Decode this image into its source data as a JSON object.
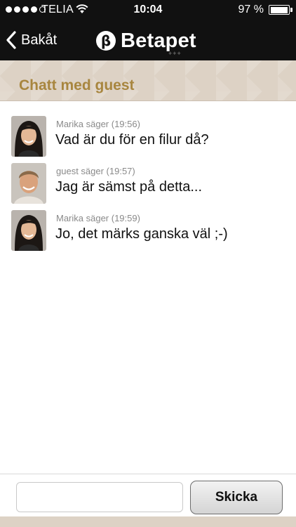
{
  "status_bar": {
    "signal_bars_filled": 4,
    "signal_bars_total": 5,
    "carrier": "TELIA",
    "time": "10:04",
    "battery": "97 %",
    "battery_level": 0.97
  },
  "nav": {
    "back_label": "Bakåt",
    "logo_text": "Betapet",
    "logo_mark_glyph": "β",
    "logo_subtext": "+++"
  },
  "header": {
    "title": "Chatt med guest"
  },
  "messages": [
    {
      "meta": "Marika säger (19:56)",
      "text": "Vad är du för en filur då?",
      "avatar": "woman-avatar"
    },
    {
      "meta": "guest säger (19:57)",
      "text": "Jag är sämst på detta...",
      "avatar": "man-avatar"
    },
    {
      "meta": "Marika säger (19:59)",
      "text": "Jo, det märks ganska väl ;-)",
      "avatar": "woman-avatar"
    }
  ],
  "composer": {
    "input_value": "",
    "input_placeholder": "",
    "send_label": "Skicka"
  },
  "colors": {
    "top_bar": "#111111",
    "header_band": "#ddd2c5",
    "header_title": "#a8863f",
    "meta_text": "#8a8a8a"
  }
}
